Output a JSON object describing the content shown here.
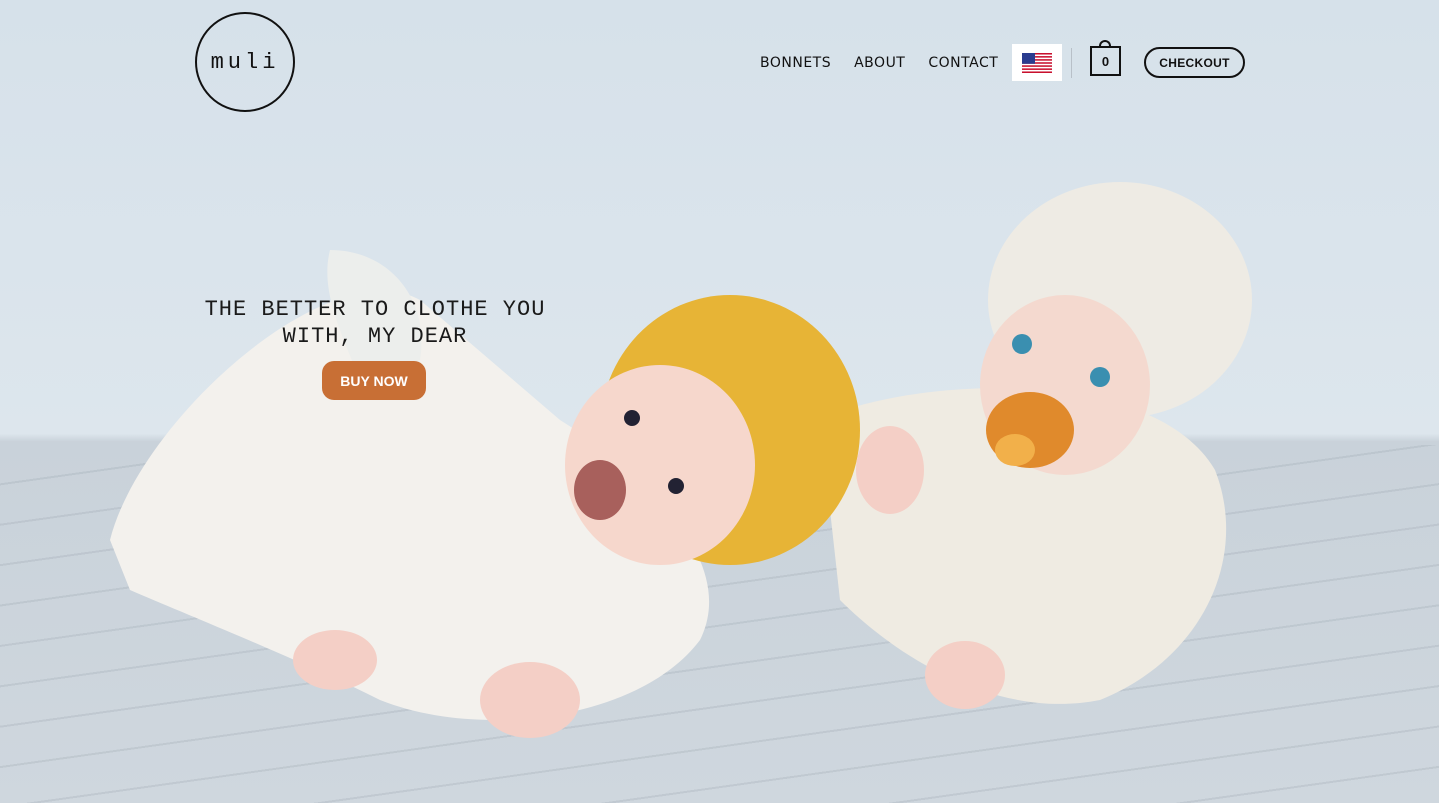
{
  "header": {
    "logo_text": "muli",
    "nav": [
      {
        "label": "BONNETS"
      },
      {
        "label": "ABOUT"
      },
      {
        "label": "CONTACT"
      }
    ],
    "country_flag_icon": "us-flag-icon",
    "cart_count": "0",
    "checkout_label": "CHECKOUT"
  },
  "hero": {
    "headline_line1": "THE BETTER TO CLOTHE YOU",
    "headline_line2": "WITH, MY DEAR",
    "cta_label": "BUY NOW",
    "cta_color": "#c86f35",
    "image": "hero-photo-babies-in-knit-bonnets"
  }
}
